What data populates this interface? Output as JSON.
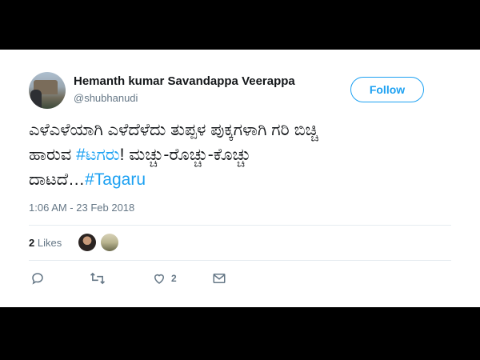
{
  "tweet": {
    "user": {
      "name": "Hemanth kumar Savandappa Veerappa",
      "handle": "@shubhanudi",
      "avatar_icon": "profile-photo"
    },
    "follow_label": "Follow",
    "text_parts": {
      "line1": "ಎಳೆಎಳೆಯಾಗಿ ಎಳೆದೆಳೆದು ತುಪ್ಪಳ ಪುಕ್ಕಗಳಾಗಿ ಗರಿ ಬಿಚ್ಚಿ",
      "line2_pre": "ಹಾರುವ ",
      "hashtag1": "#ಟಗರು",
      "line2_post": "! ಮಚ್ಚು-ರೊಚ್ಚು-ಕೊಚ್ಚು",
      "line3_pre": "ದಾಟದೆ…",
      "hashtag2": "#Tagaru"
    },
    "timestamp": "1:06 AM - 23 Feb 2018",
    "likes": {
      "count": "2",
      "label": "Likes"
    },
    "actions": {
      "reply_icon": "reply-icon",
      "retweet_icon": "retweet-icon",
      "like_icon": "heart-icon",
      "like_count": "2",
      "message_icon": "mail-icon"
    },
    "colors": {
      "accent": "#1da1f2",
      "text": "#14171a",
      "secondary": "#657786"
    }
  }
}
